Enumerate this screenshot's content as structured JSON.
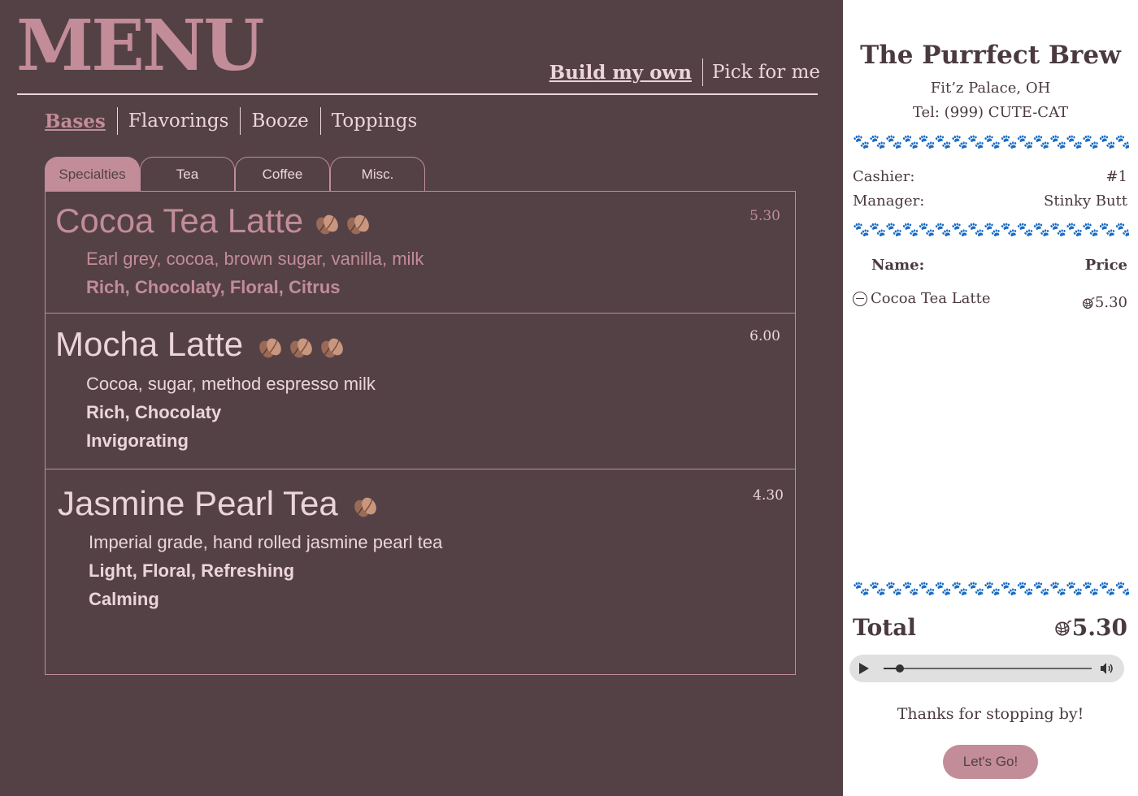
{
  "menu": {
    "title": "MENU",
    "modes": [
      {
        "label": "Build my own",
        "active": true
      },
      {
        "label": "Pick for me",
        "active": false
      }
    ],
    "categories": [
      {
        "label": "Bases",
        "active": true
      },
      {
        "label": "Flavorings",
        "active": false
      },
      {
        "label": "Booze",
        "active": false
      },
      {
        "label": "Toppings",
        "active": false
      }
    ],
    "tabs": [
      {
        "label": "Specialties",
        "active": true
      },
      {
        "label": "Tea",
        "active": false
      },
      {
        "label": "Coffee",
        "active": false
      },
      {
        "label": "Misc.",
        "active": false
      }
    ],
    "items": [
      {
        "name": "Cocoa Tea Latte",
        "caffeine_beans": 2,
        "price": "5.30",
        "description": "Earl grey, cocoa, brown sugar, vanilla, milk",
        "tags": [
          "Rich, Chocolaty, Floral, Citrus"
        ],
        "selected": true
      },
      {
        "name": "Mocha Latte",
        "caffeine_beans": 3,
        "price": "6.00",
        "description": "Cocoa, sugar, method espresso milk",
        "tags": [
          "Rich, Chocolaty",
          "Invigorating"
        ],
        "selected": false
      },
      {
        "name": "Jasmine Pearl Tea",
        "caffeine_beans": 1,
        "price": "4.30",
        "description": "Imperial grade, hand rolled jasmine pearl tea",
        "tags": [
          "Light, Floral, Refreshing",
          "Calming"
        ],
        "selected": false
      }
    ],
    "icons": {
      "caffeine": "coffee-bean-icon"
    }
  },
  "receipt": {
    "shop_name": "The Purrfect Brew",
    "address": "Fit’z Palace, OH",
    "phone": "Tel: (999) CUTE-CAT",
    "divider_glyphs": "🐾🐾🐾🐾🐾🐾🐾🐾🐾🐾🐾🐾🐾🐾🐾🐾🐾🐾🐾🐾🐾🐾🐾🐾",
    "cashier_label": "Cashier:",
    "cashier_value": "#1",
    "manager_label": "Manager:",
    "manager_value": "Stinky Butt",
    "col_name": "Name:",
    "col_price": "Price",
    "order": [
      {
        "name": "Cocoa Tea Latte",
        "price": "5.30"
      }
    ],
    "total_label": "Total",
    "total_value": "5.30",
    "currency_icon": "yarn-ball-icon",
    "audio_progress": 0.08,
    "thanks": "Thanks for stopping by!",
    "go_label": "Let's Go!"
  },
  "colors": {
    "background": "#534146",
    "accent": "#c28c99",
    "text_light": "#ecd5da",
    "receipt_bg": "#ffffff",
    "receipt_text": "#4a3a3f"
  }
}
